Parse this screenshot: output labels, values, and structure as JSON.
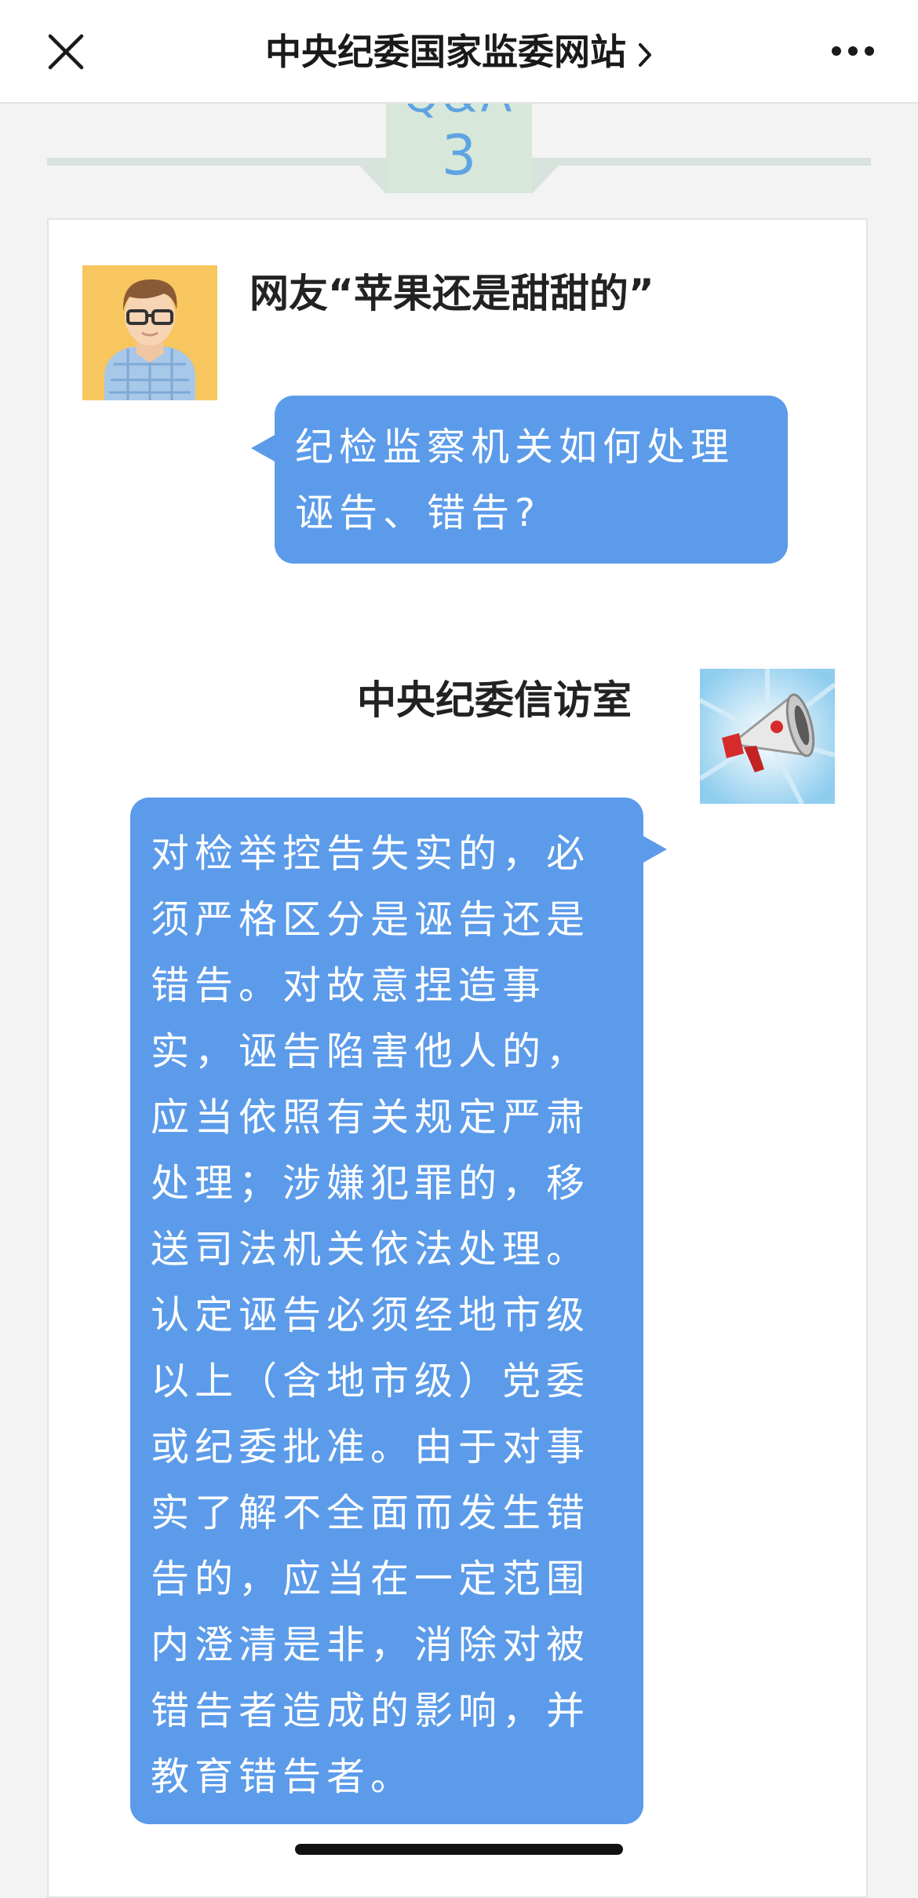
{
  "navbar": {
    "close_icon": "close-icon",
    "title": "中央纪委国家监委网站",
    "chevron_icon": "chevron-right-icon",
    "more_icon": "more-horizontal-icon"
  },
  "banner": {
    "ghost_text": "Q&A",
    "number": "3",
    "accent_color": "#5fa4e2",
    "tab_color": "#d7e8da"
  },
  "question": {
    "avatar_icon": "user-avatar-icon",
    "asker": "网友“苹果还是甜甜的”",
    "text": "纪检监察机关如何处理\n诬告、错告?"
  },
  "answer": {
    "responder": "中央纪委信访室",
    "megaphone_icon": "megaphone-icon",
    "text": "对检举控告失实的，必\n须严格区分是诬告还是\n错告。对故意捏造事\n实，诬告陷害他人的，\n应当依照有关规定严肃\n处理；涉嫌犯罪的，移\n送司法机关依法处理。\n认定诬告必须经地市级\n以上（含地市级）党委\n或纪委批准。由于对事\n实了解不全面而发生错\n告的，应当在一定范围\n内澄清是非，消除对被\n错告者造成的影响，并\n教育错告者。"
  },
  "colors": {
    "bubble": "#5b9bea",
    "bubble_text": "#ffffff"
  }
}
